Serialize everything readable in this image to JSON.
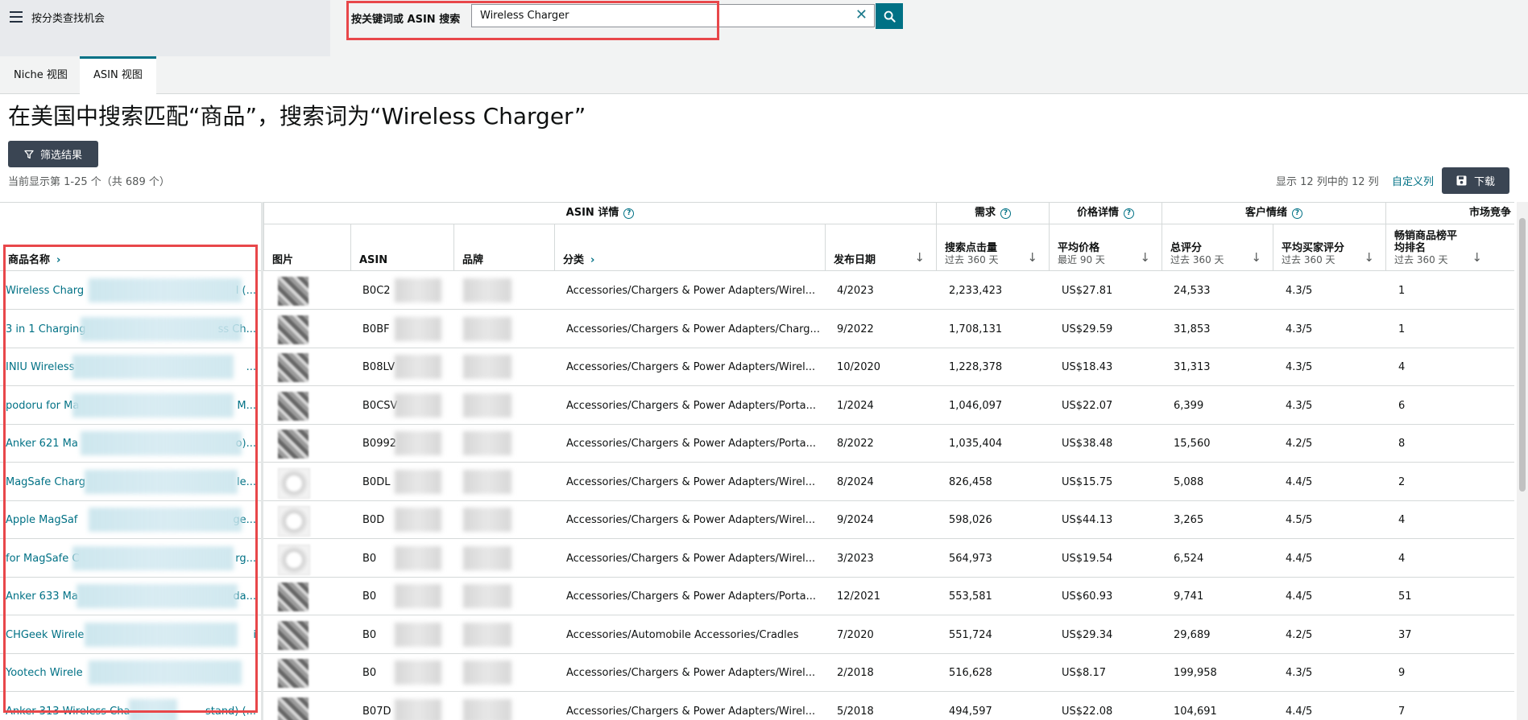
{
  "nav": {
    "label": "按分类查找机会"
  },
  "search": {
    "label": "按关键词或 ASIN 搜索",
    "value": "Wireless Charger"
  },
  "tabs": [
    {
      "label": "Niche 视图"
    },
    {
      "label": "ASIN 视图"
    }
  ],
  "title": "在美国中搜索匹配“商品”，搜索词为“Wireless Charger”",
  "filter_label": "筛选结果",
  "showing": "当前显示第 1-25 个（共 689 个）",
  "columns_info": "显示 12 列中的 12 列",
  "custom_link": "自定义列",
  "download_label": "下载",
  "groups": {
    "asin": "ASIN 详情",
    "demand": "需求",
    "price": "价格详情",
    "customer": "客户情绪",
    "market": "市场竞争"
  },
  "columns": {
    "product_name": "商品名称",
    "image": "图片",
    "asin": "ASIN",
    "brand": "品牌",
    "category": "分类",
    "launch_date": "发布日期",
    "search_clicks": "搜索点击量",
    "search_clicks_sub": "过去 360 天",
    "avg_price": "平均价格",
    "avg_price_sub": "最近 90 天",
    "total_ratings": "总评分",
    "total_ratings_sub": "过去 360 天",
    "avg_rating": "平均买家评分",
    "avg_rating_sub": "过去 360 天",
    "bsr": "畅销商品榜平均排名",
    "bsr_sub": "过去 360 天"
  },
  "rows": [
    {
      "name": "Wireless Charg",
      "name_tail": "l (...",
      "asin": "B0C2",
      "category": "Accessories/Chargers & Power Adapters/Wirel...",
      "date": "4/2023",
      "clicks": "2,233,423",
      "price": "US$27.81",
      "ratings": "24,533",
      "rating": "4.3/5",
      "bsr": "1"
    },
    {
      "name": "3 in 1 Charging",
      "name_tail": "ss Ch...",
      "asin": "B0BF",
      "category": "Accessories/Chargers & Power Adapters/Charg...",
      "date": "9/2022",
      "clicks": "1,708,131",
      "price": "US$29.59",
      "ratings": "31,853",
      "rating": "4.3/5",
      "bsr": "1"
    },
    {
      "name": "INIU Wireless",
      "name_tail": "...",
      "asin": "B08LV",
      "category": "Accessories/Chargers & Power Adapters/Wirel...",
      "date": "10/2020",
      "clicks": "1,228,378",
      "price": "US$18.43",
      "ratings": "31,313",
      "rating": "4.3/5",
      "bsr": "4"
    },
    {
      "name": "podoru for Ma",
      "name_tail": "M...",
      "asin": "B0CSV",
      "category": "Accessories/Chargers & Power Adapters/Porta...",
      "date": "1/2024",
      "clicks": "1,046,097",
      "price": "US$22.07",
      "ratings": "6,399",
      "rating": "4.3/5",
      "bsr": "6"
    },
    {
      "name": "Anker 621 Ma",
      "name_tail": "o)...",
      "asin": "B0992",
      "category": "Accessories/Chargers & Power Adapters/Porta...",
      "date": "8/2022",
      "clicks": "1,035,404",
      "price": "US$38.48",
      "ratings": "15,560",
      "rating": "4.2/5",
      "bsr": "8"
    },
    {
      "name": "MagSafe Charg",
      "name_tail": "le...",
      "asin": "B0DL",
      "category": "Accessories/Chargers & Power Adapters/Wirel...",
      "date": "8/2024",
      "clicks": "826,458",
      "price": "US$15.75",
      "ratings": "5,088",
      "rating": "4.4/5",
      "bsr": "2"
    },
    {
      "name": "Apple MagSaf",
      "name_tail": "ge...",
      "asin": "B0D",
      "category": "Accessories/Chargers & Power Adapters/Wirel...",
      "date": "9/2024",
      "clicks": "598,026",
      "price": "US$44.13",
      "ratings": "3,265",
      "rating": "4.5/5",
      "bsr": "4"
    },
    {
      "name": "for MagSafe C",
      "name_tail": "rg...",
      "asin": "B0",
      "category": "Accessories/Chargers & Power Adapters/Wirel...",
      "date": "3/2023",
      "clicks": "564,973",
      "price": "US$19.54",
      "ratings": "6,524",
      "rating": "4.4/5",
      "bsr": "4"
    },
    {
      "name": "Anker 633 Ma",
      "name_tail": "da...",
      "asin": "B0",
      "category": "Accessories/Chargers & Power Adapters/Porta...",
      "date": "12/2021",
      "clicks": "553,581",
      "price": "US$60.93",
      "ratings": "9,741",
      "rating": "4.4/5",
      "bsr": "51"
    },
    {
      "name": "CHGeek Wirele",
      "name_tail": "i",
      "asin": "B0",
      "category": "Accessories/Automobile Accessories/Cradles",
      "date": "7/2020",
      "clicks": "551,724",
      "price": "US$29.34",
      "ratings": "29,689",
      "rating": "4.2/5",
      "bsr": "37"
    },
    {
      "name": "Yootech Wirele",
      "name_tail": "",
      "asin": "B0",
      "category": "Accessories/Chargers & Power Adapters/Wirel...",
      "date": "2/2018",
      "clicks": "516,628",
      "price": "US$8.17",
      "ratings": "199,958",
      "rating": "4.3/5",
      "bsr": "9"
    },
    {
      "name": "Anker 313 Wireless Cha",
      "name_tail": "stand) (...",
      "asin": "B07D",
      "category": "Accessories/Chargers & Power Adapters/Wirel...",
      "date": "5/2018",
      "clicks": "494,597",
      "price": "US$22.08",
      "ratings": "104,691",
      "rating": "4.4/5",
      "bsr": "7"
    }
  ],
  "colors": {
    "accent": "#007185",
    "highlight": "#e8474a",
    "button_dark": "#3a4553"
  }
}
